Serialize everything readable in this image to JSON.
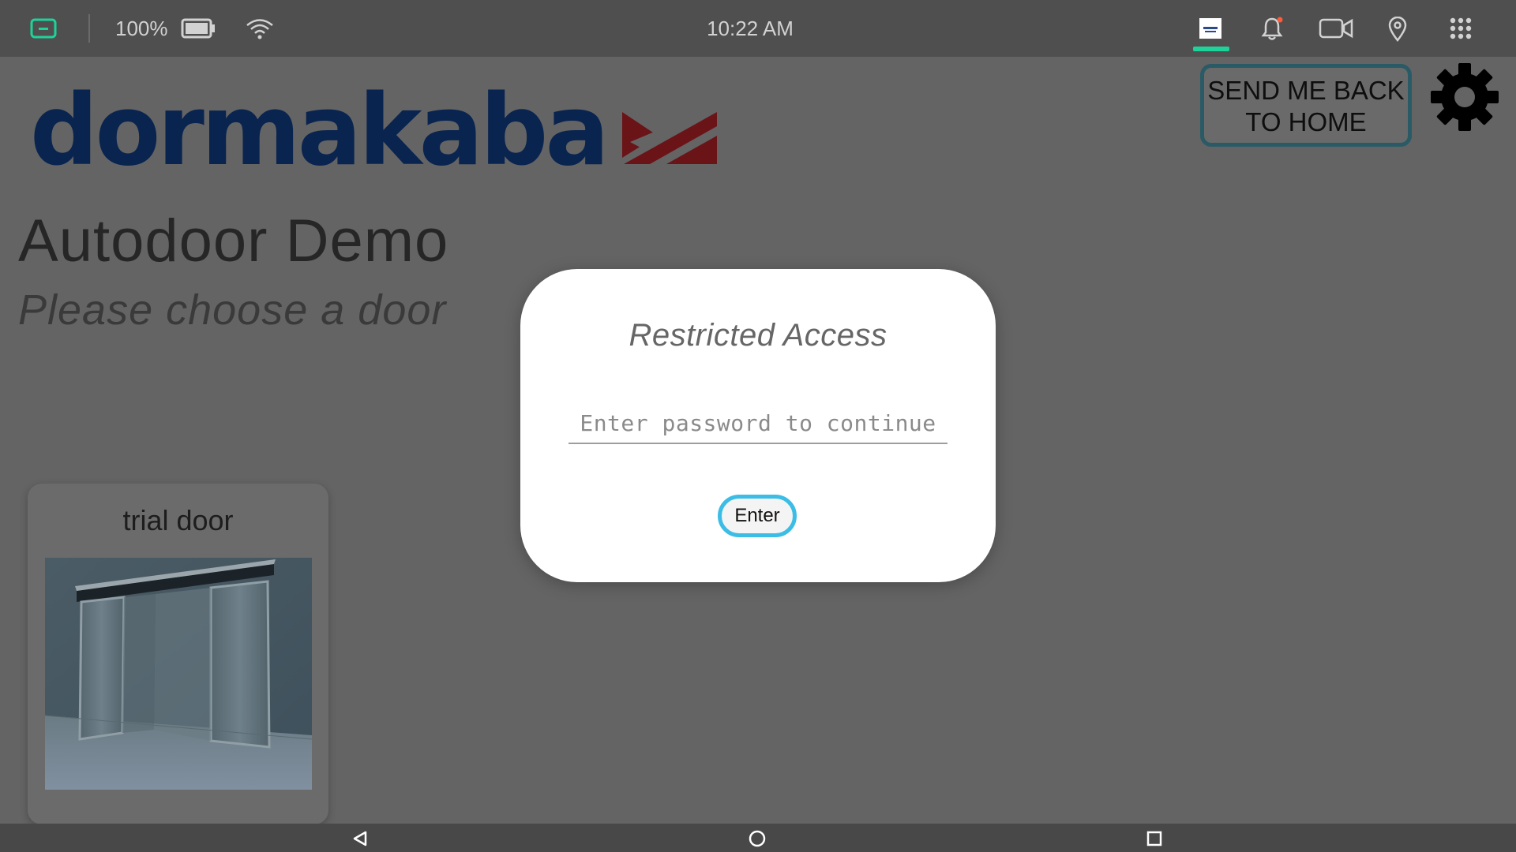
{
  "status_bar": {
    "battery_percent": "100%",
    "time": "10:22 AM",
    "icons": [
      "screen-mode-icon",
      "battery-icon",
      "wifi-icon",
      "app-thumbnail-icon",
      "notification-bell-icon",
      "video-camera-icon",
      "location-pin-icon",
      "apps-grid-icon"
    ],
    "accent_color": "#1ed39a",
    "notification_dot_color": "#ff5a3c"
  },
  "header": {
    "brand": "dormakaba",
    "brand_color": "#0a2450",
    "brand_mark_color": "#6b1418",
    "home_button_label": "SEND ME BACK TO HOME",
    "settings_icon": "gear-icon"
  },
  "main": {
    "title": "Autodoor Demo",
    "subtitle": "Please choose a door",
    "doors": [
      {
        "label": "trial door",
        "image": "sliding-glass-door-photo"
      }
    ]
  },
  "dialog": {
    "title": "Restricted Access",
    "password": {
      "value": "",
      "placeholder": "Enter password to continue"
    },
    "enter_label": "Enter",
    "button_border_color": "#3bbde6"
  },
  "nav_bar": {
    "icons": [
      "back-icon",
      "home-icon",
      "recents-icon"
    ]
  }
}
